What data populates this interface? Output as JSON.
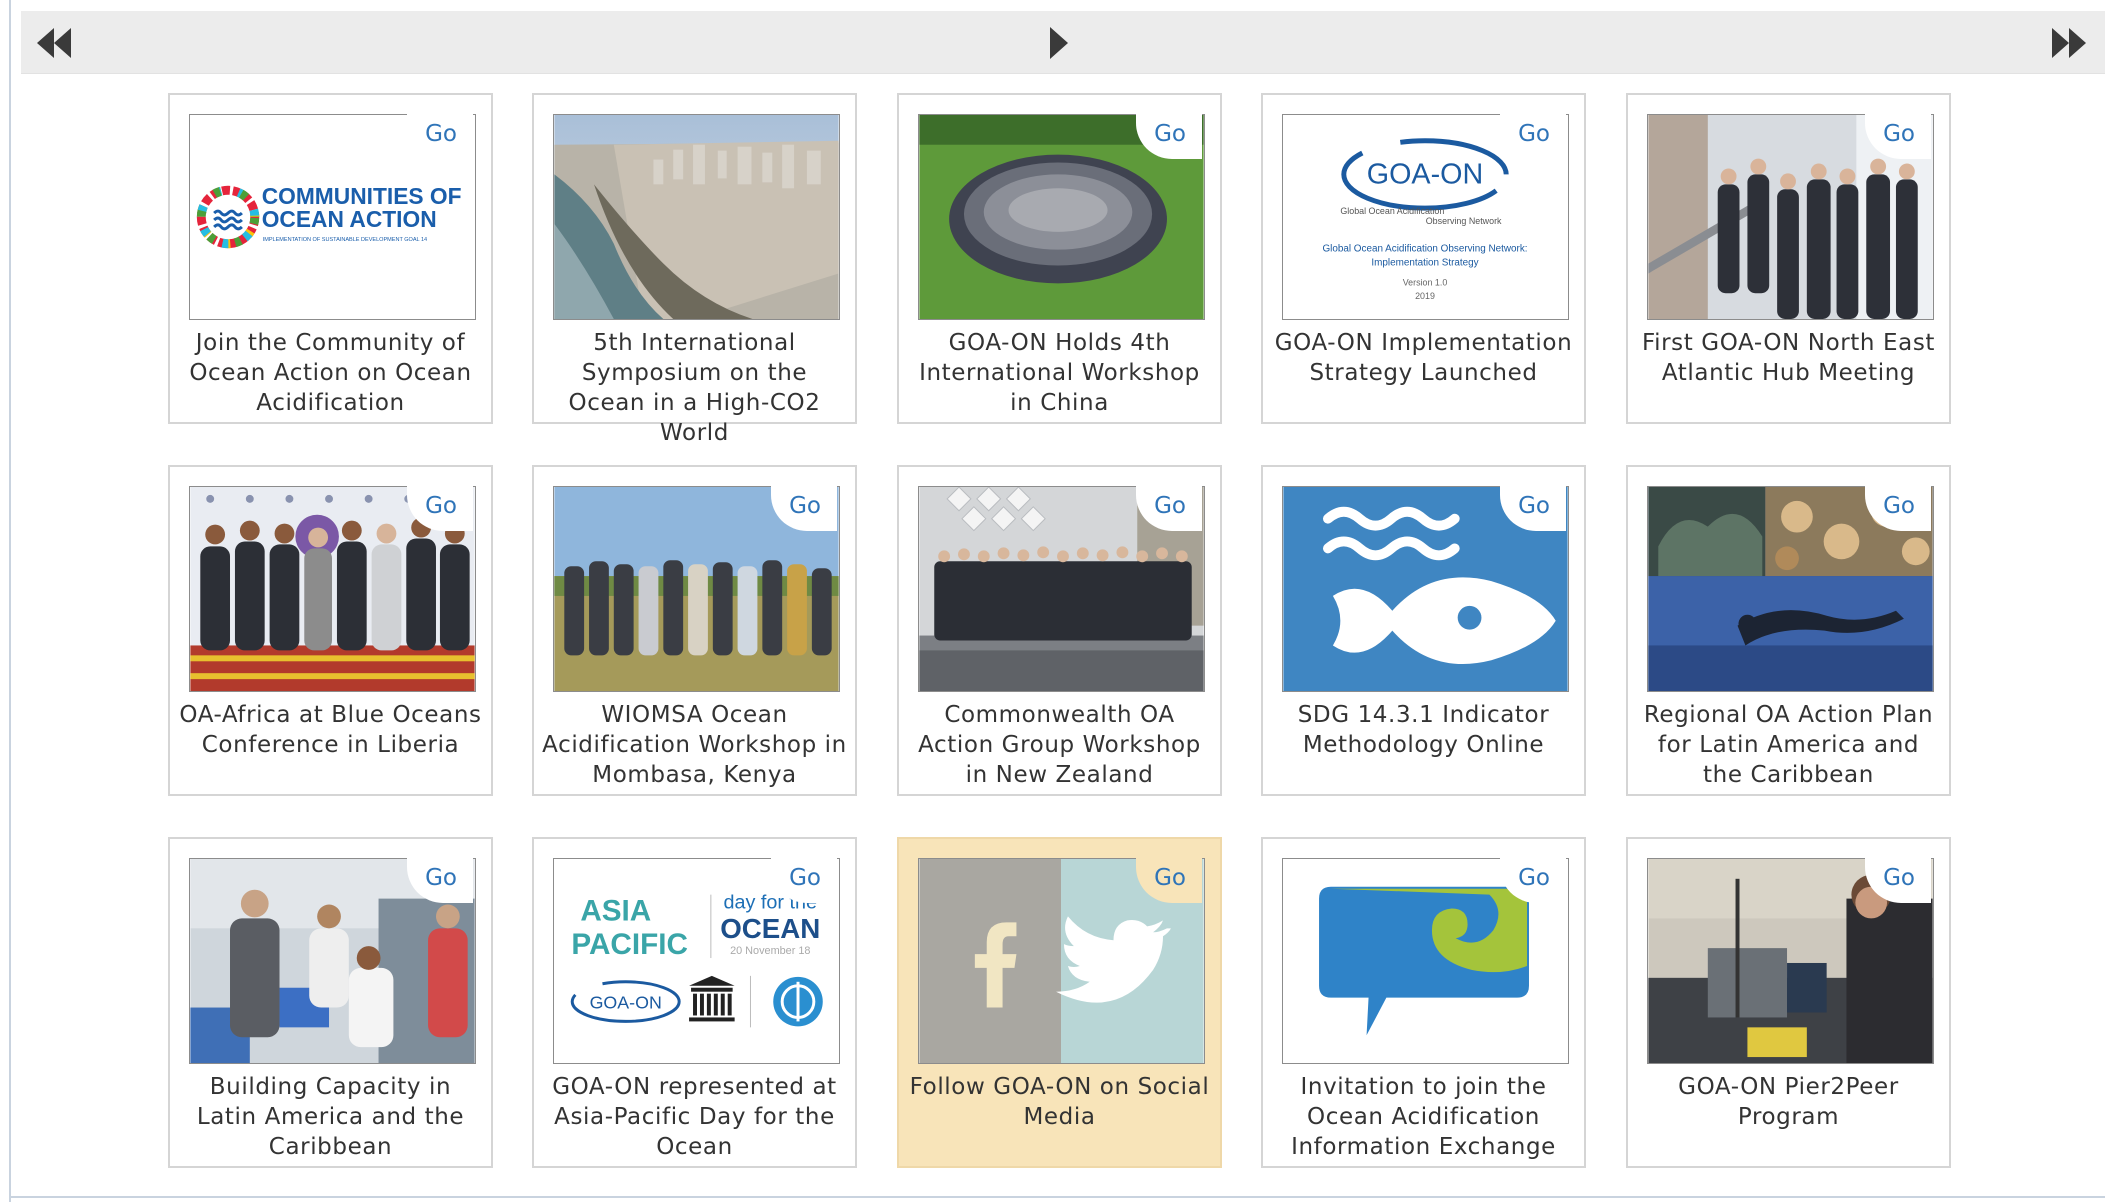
{
  "pager": {
    "first_icon": "double-chevron-left-icon",
    "next_icon": "play-right-icon",
    "last_icon": "double-chevron-right-icon"
  },
  "colors": {
    "go_link": "#2f74b8",
    "caption_text": "#333333",
    "tile_border": "#d5d5d5",
    "highlight_bg": "#f8e4b9",
    "navbar_bg": "#ececec"
  },
  "tiles": [
    {
      "caption": "Join the Community of Ocean Action on Ocean Acidification",
      "go": "Go",
      "thumb": {
        "line1": "COMMUNITIES OF",
        "line2": "OCEAN ACTION",
        "line3": "IMPLEMENTATION OF SUSTAINABLE DEVELOPMENT GOAL 14"
      }
    },
    {
      "caption": "5th International Symposium on the Ocean in a High-CO2 World",
      "go": "Go"
    },
    {
      "caption": "GOA-ON Holds 4th International Workshop in China",
      "go": "Go"
    },
    {
      "caption": "GOA-ON Implementation Strategy Launched",
      "go": "Go",
      "thumb": {
        "logo": "GOA-ON",
        "sub1": "Global Ocean Acidification",
        "sub2": "Observing Network",
        "title1": "Global Ocean Acidification Observing Network:",
        "title2": "Implementation Strategy",
        "version": "Version 1.0",
        "year": "2019"
      }
    },
    {
      "caption": "First GOA-ON North East Atlantic Hub Meeting",
      "go": "Go"
    },
    {
      "caption": "OA-Africa at Blue Oceans Conference in Liberia",
      "go": "Go"
    },
    {
      "caption": "WIOMSA Ocean Acidification Workshop in Mombasa, Kenya",
      "go": "Go"
    },
    {
      "caption": "Commonwealth OA Action Group Workshop in New Zealand",
      "go": "Go"
    },
    {
      "caption": "SDG 14.3.1 Indicator Methodology Online",
      "go": "Go"
    },
    {
      "caption": "Regional OA Action Plan for Latin America and the Caribbean",
      "go": "Go"
    },
    {
      "caption": "Building Capacity in Latin America and the Caribbean",
      "go": "Go"
    },
    {
      "caption": "GOA-ON represented at Asia-Pacific Day for the Ocean",
      "go": "Go",
      "thumb": {
        "asia": "ASIA",
        "pacific": "PACIFIC",
        "dayfor": "day for the",
        "ocean": "OCEAN",
        "date": "20 November 18",
        "logo": "GOA-ON"
      }
    },
    {
      "caption": "Follow GOA-ON on Social Media",
      "go": "Go",
      "highlight": true
    },
    {
      "caption": "Invitation to join the Ocean Acidification Information Exchange",
      "go": "Go"
    },
    {
      "caption": "GOA-ON Pier2Peer Program",
      "go": "Go"
    }
  ]
}
